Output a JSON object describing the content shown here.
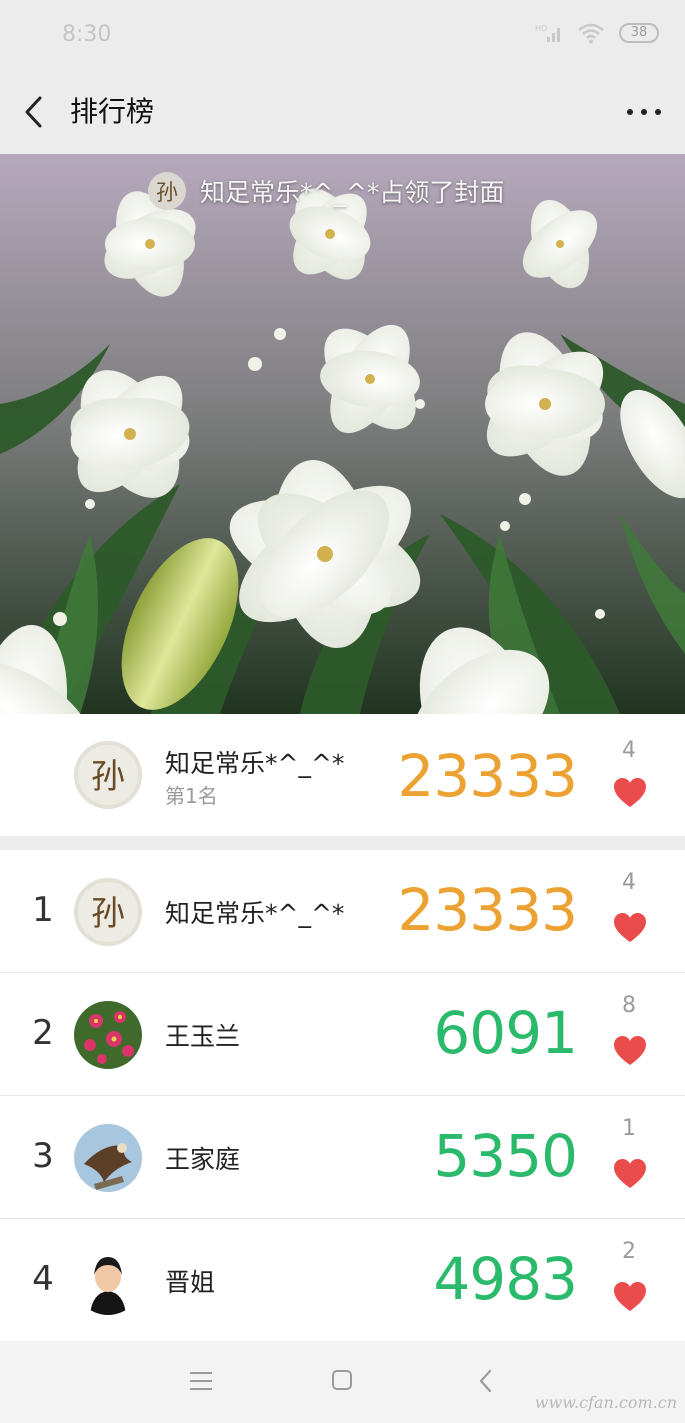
{
  "status_bar": {
    "time": "8:30",
    "battery": "38"
  },
  "nav": {
    "title": "排行榜"
  },
  "cover": {
    "avatar_char": "孙",
    "caption": "知足常乐*^_^*占领了封面"
  },
  "my_card": {
    "avatar_char": "孙",
    "name": "知足常乐*^_^*",
    "rank_label": "第1名",
    "steps": "23333",
    "likes": "4"
  },
  "rankings": [
    {
      "rank": "1",
      "name": "知足常乐*^_^*",
      "steps": "23333",
      "likes": "4",
      "color": "#eca133",
      "avatar_char": "孙"
    },
    {
      "rank": "2",
      "name": "王玉兰",
      "steps": "6091",
      "likes": "8",
      "color": "#2bb96b"
    },
    {
      "rank": "3",
      "name": "王家庭",
      "steps": "5350",
      "likes": "1",
      "color": "#2bb96b"
    },
    {
      "rank": "4",
      "name": "晋姐",
      "steps": "4983",
      "likes": "2",
      "color": "#2bb96b"
    }
  ],
  "colors": {
    "accent_orange": "#eca133",
    "accent_green": "#2bb96b",
    "heart": "#ea4b4b"
  },
  "watermark": "www.cfan.com.cn"
}
